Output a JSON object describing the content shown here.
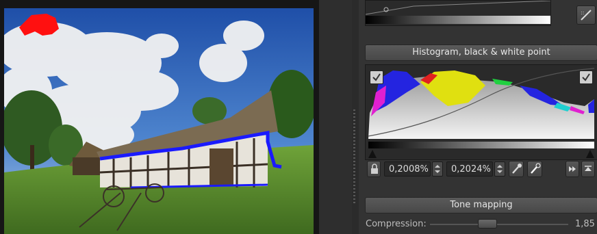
{
  "histogram_section": {
    "title": "Histogram, black & white point",
    "black_point": "0,2008%",
    "white_point": "0,2024%"
  },
  "tone_mapping": {
    "title": "Tone mapping",
    "compression_label": "Compression:",
    "compression_value": "1,85",
    "compression_fraction": 0.4
  },
  "colors": {
    "panel_bg": "#333333",
    "clip_highlight": "#ff1010",
    "clip_shadow": "#1a1aff"
  },
  "icons": [
    "curve-edit-icon",
    "lock-icon",
    "spin-up-icon",
    "spin-down-icon",
    "eyedropper-icon",
    "eyedropper-white-icon",
    "next-icon",
    "flip-icon",
    "check-icon"
  ]
}
